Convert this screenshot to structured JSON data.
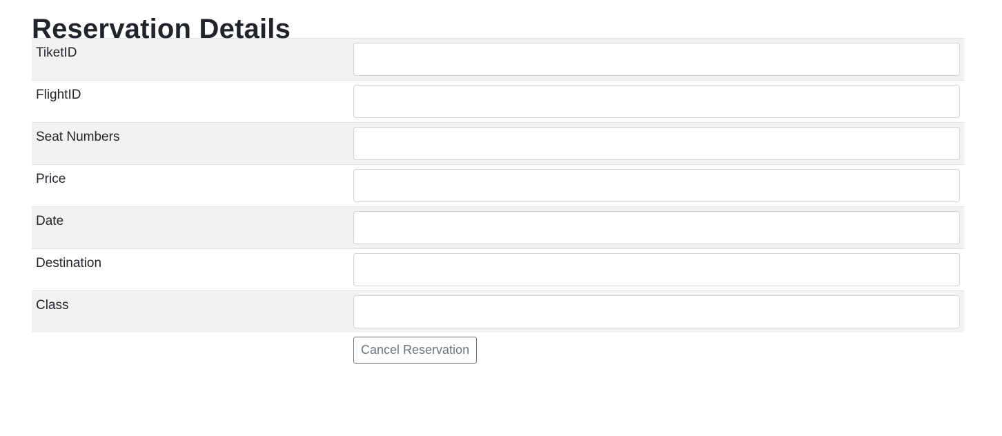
{
  "page": {
    "title": "Reservation Details"
  },
  "form": {
    "fields": [
      {
        "label": "TiketID",
        "value": ""
      },
      {
        "label": "FlightID",
        "value": ""
      },
      {
        "label": "Seat Numbers",
        "value": ""
      },
      {
        "label": "Price",
        "value": ""
      },
      {
        "label": "Date",
        "value": ""
      },
      {
        "label": "Destination",
        "value": ""
      },
      {
        "label": "Class",
        "value": ""
      }
    ],
    "cancel_label": "Cancel Reservation"
  },
  "colors": {
    "stripe": "#f2f2f2",
    "border": "#dee2e6",
    "button_outline": "#6c757d"
  }
}
